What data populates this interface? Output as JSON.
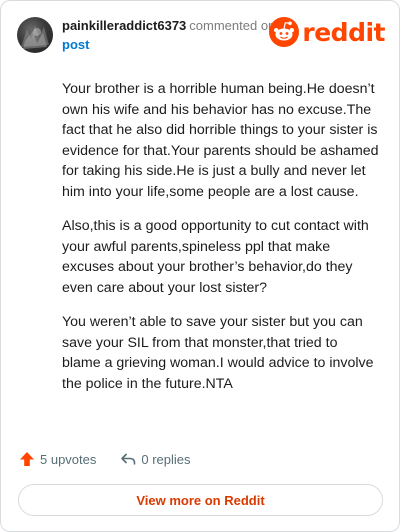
{
  "comment": {
    "username": "painkilleraddict6373",
    "commented_text": "commented on",
    "post_link": "post",
    "paragraphs": [
      "Your brother is a horrible human being.He doesn’t own his wife and his behavior has no excuse.The fact that he also did horrible things to your sister is evidence for that.Your parents should be ashamed for taking his side.He is just a bully and never let him into your life,some people are a lost cause.",
      "Also,this is a good opportunity to cut contact with your awful parents,spineless ppl that make excuses about your brother’s behavior,do they even care about your lost sister?",
      "You weren’t able to save your sister but you can save your SIL from that monster,that tried to blame a grieving woman.I would advice to involve the police in the future.NTA"
    ]
  },
  "brand": {
    "logo_text": "reddit",
    "accent_color": "#ff4500"
  },
  "footer": {
    "upvotes_label": "5 upvotes",
    "replies_label": "0 replies",
    "upvote_icon": "upvote-arrow-icon",
    "reply_icon": "reply-arrow-icon"
  },
  "view_more_label": "View more on Reddit"
}
